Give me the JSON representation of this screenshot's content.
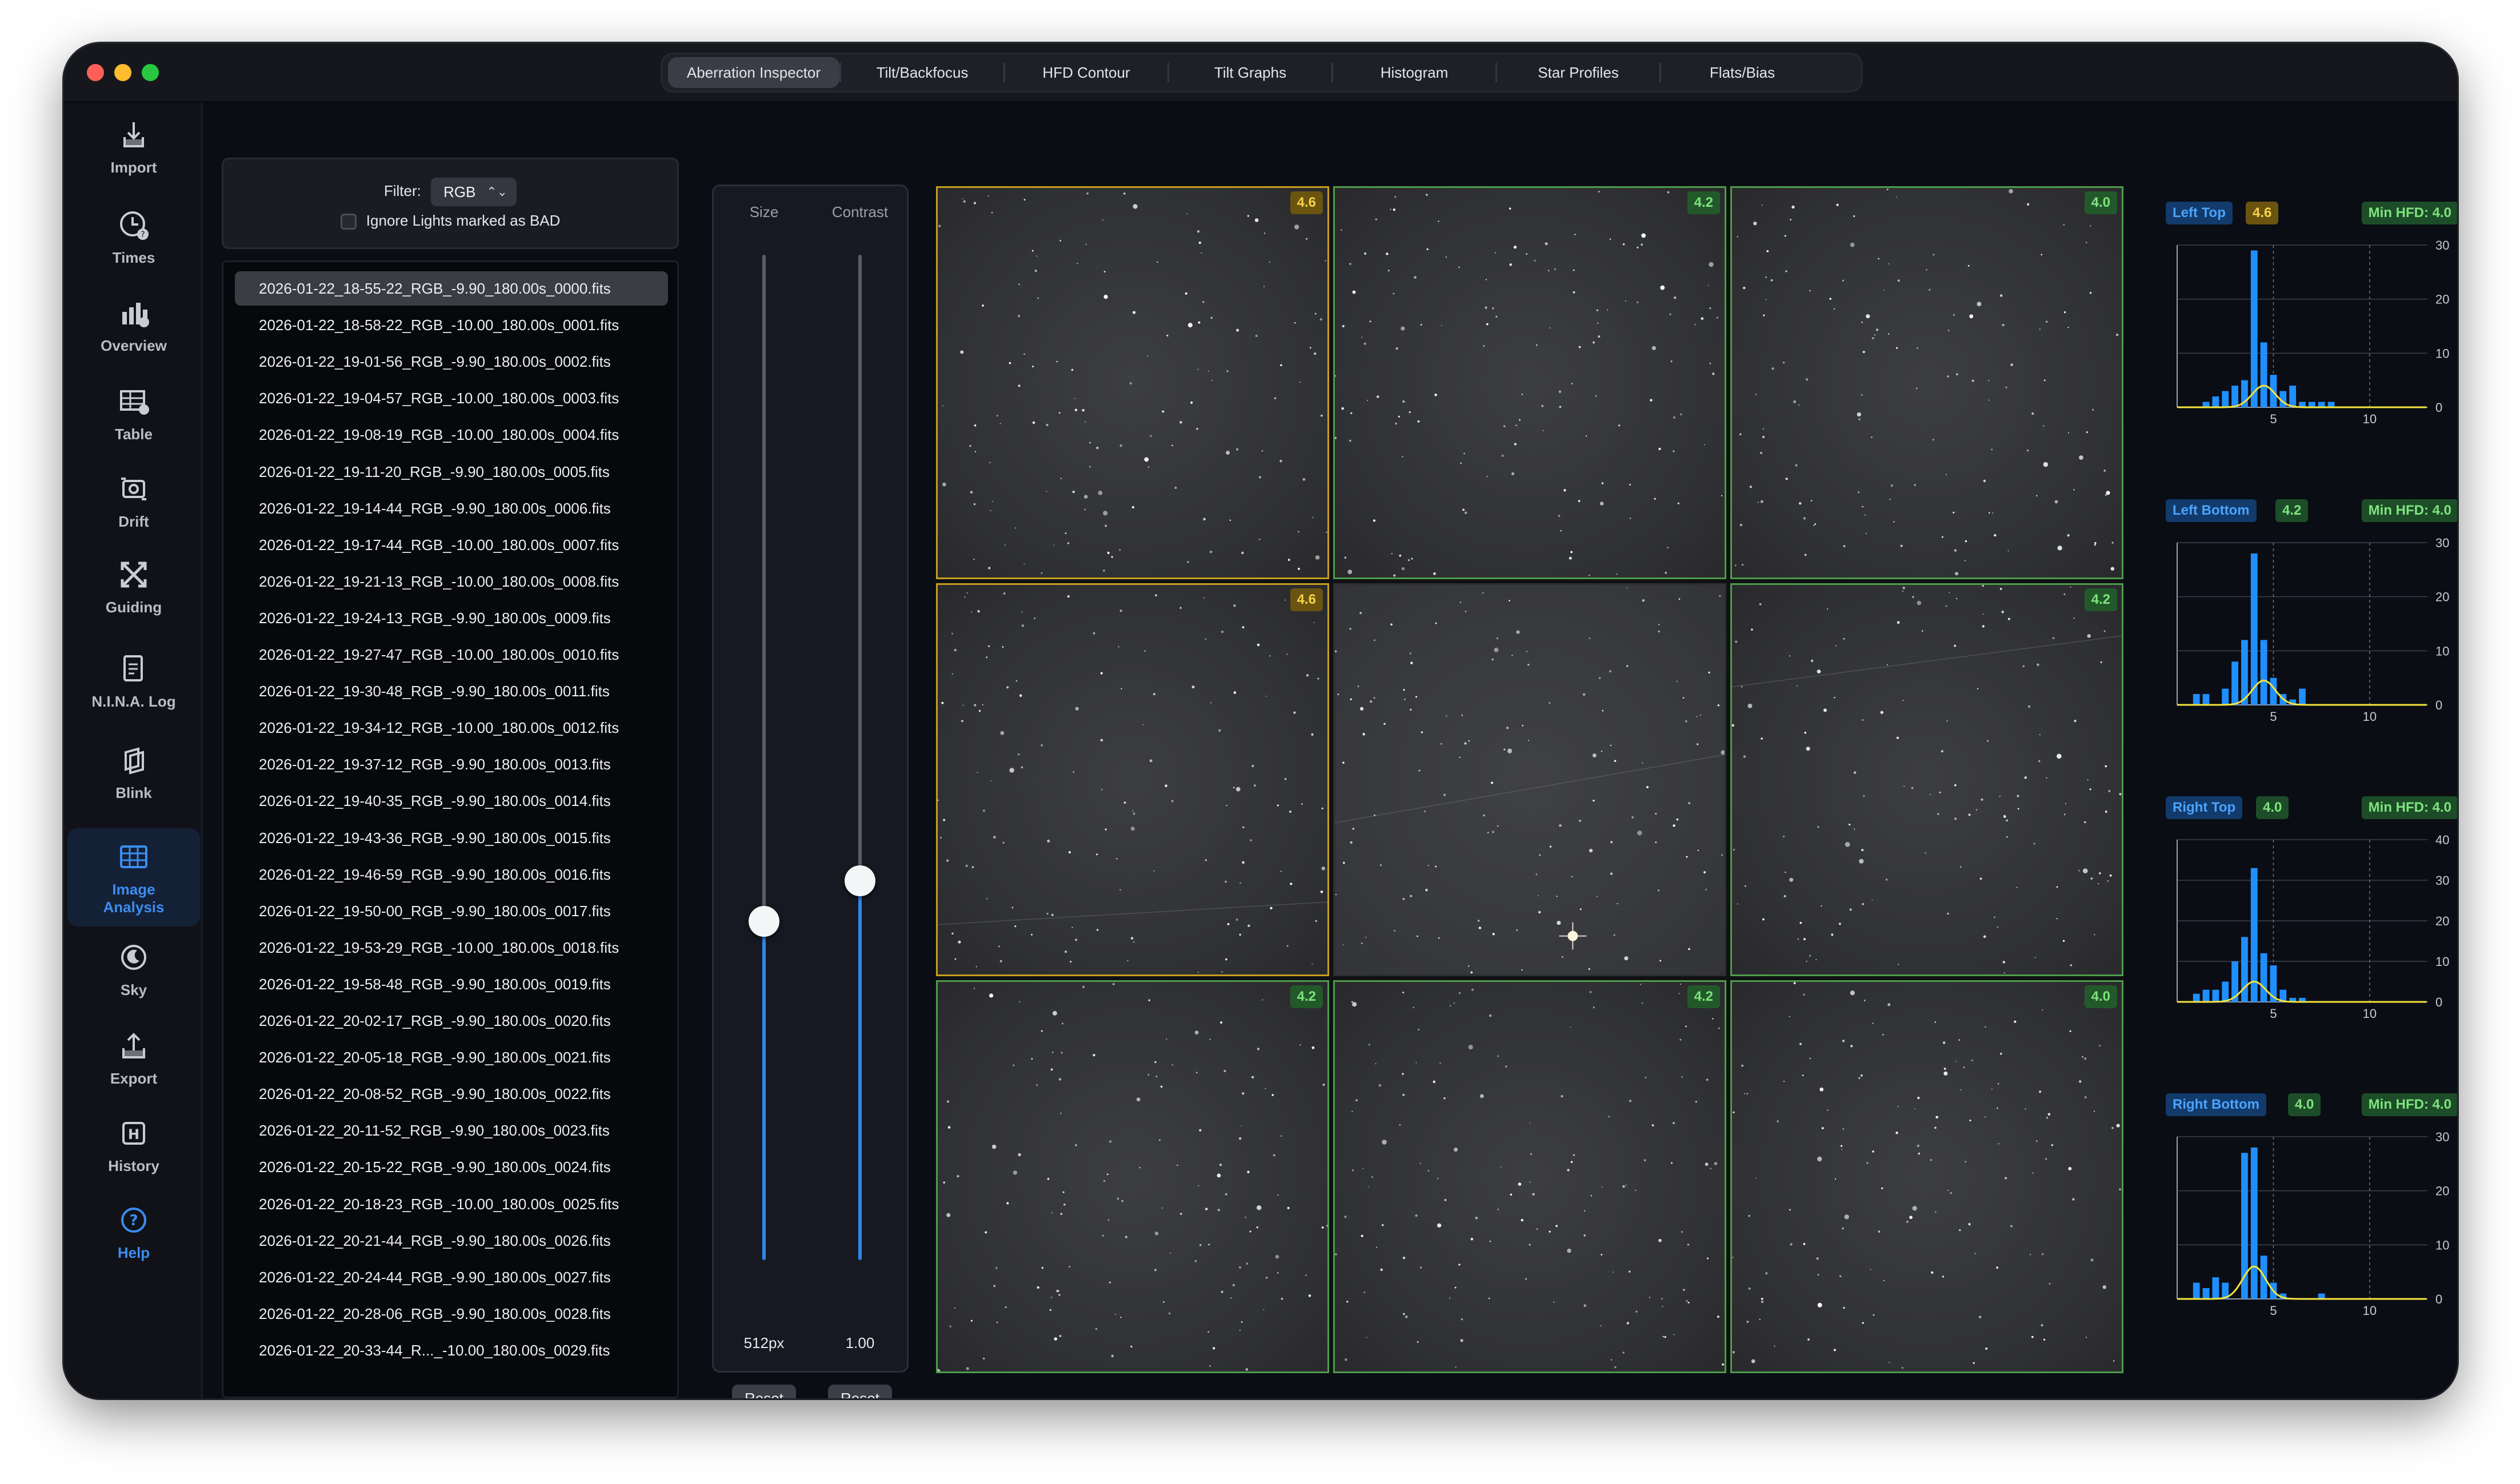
{
  "tabs": [
    {
      "label": "Aberration Inspector",
      "active": true
    },
    {
      "label": "Tilt/Backfocus",
      "active": false
    },
    {
      "label": "HFD Contour",
      "active": false
    },
    {
      "label": "Tilt Graphs",
      "active": false
    },
    {
      "label": "Histogram",
      "active": false
    },
    {
      "label": "Star Profiles",
      "active": false
    },
    {
      "label": "Flats/Bias",
      "active": false
    }
  ],
  "sidebar": [
    {
      "label": "Import",
      "icon": "import-icon"
    },
    {
      "label": "Times",
      "icon": "clock-icon"
    },
    {
      "label": "Overview",
      "icon": "bar-chart-icon"
    },
    {
      "label": "Table",
      "icon": "table-icon"
    },
    {
      "label": "Drift",
      "icon": "camera-drift-icon"
    },
    {
      "label": "Guiding",
      "icon": "guiding-arrows-icon"
    },
    {
      "label": "N.I.N.A. Log",
      "icon": "log-document-icon"
    },
    {
      "label": "Blink",
      "icon": "blink-layers-icon"
    },
    {
      "label": "Image\nAnalysis",
      "icon": "grid-icon",
      "active": true
    },
    {
      "label": "Sky",
      "icon": "moon-icon"
    },
    {
      "label": "Export",
      "icon": "export-icon"
    },
    {
      "label": "History",
      "icon": "history-icon"
    },
    {
      "label": "Help",
      "icon": "help-icon"
    }
  ],
  "filter": {
    "label": "Filter:",
    "value": "RGB",
    "ignore_label": "Ignore Lights marked as BAD",
    "ignore_checked": false
  },
  "files": [
    "2026-01-22_18-55-22_RGB_-9.90_180.00s_0000.fits",
    "2026-01-22_18-58-22_RGB_-10.00_180.00s_0001.fits",
    "2026-01-22_19-01-56_RGB_-9.90_180.00s_0002.fits",
    "2026-01-22_19-04-57_RGB_-10.00_180.00s_0003.fits",
    "2026-01-22_19-08-19_RGB_-10.00_180.00s_0004.fits",
    "2026-01-22_19-11-20_RGB_-9.90_180.00s_0005.fits",
    "2026-01-22_19-14-44_RGB_-9.90_180.00s_0006.fits",
    "2026-01-22_19-17-44_RGB_-10.00_180.00s_0007.fits",
    "2026-01-22_19-21-13_RGB_-10.00_180.00s_0008.fits",
    "2026-01-22_19-24-13_RGB_-9.90_180.00s_0009.fits",
    "2026-01-22_19-27-47_RGB_-10.00_180.00s_0010.fits",
    "2026-01-22_19-30-48_RGB_-9.90_180.00s_0011.fits",
    "2026-01-22_19-34-12_RGB_-10.00_180.00s_0012.fits",
    "2026-01-22_19-37-12_RGB_-9.90_180.00s_0013.fits",
    "2026-01-22_19-40-35_RGB_-9.90_180.00s_0014.fits",
    "2026-01-22_19-43-36_RGB_-9.90_180.00s_0015.fits",
    "2026-01-22_19-46-59_RGB_-9.90_180.00s_0016.fits",
    "2026-01-22_19-50-00_RGB_-9.90_180.00s_0017.fits",
    "2026-01-22_19-53-29_RGB_-10.00_180.00s_0018.fits",
    "2026-01-22_19-58-48_RGB_-9.90_180.00s_0019.fits",
    "2026-01-22_20-02-17_RGB_-9.90_180.00s_0020.fits",
    "2026-01-22_20-05-18_RGB_-9.90_180.00s_0021.fits",
    "2026-01-22_20-08-52_RGB_-9.90_180.00s_0022.fits",
    "2026-01-22_20-11-52_RGB_-9.90_180.00s_0023.fits",
    "2026-01-22_20-15-22_RGB_-9.90_180.00s_0024.fits",
    "2026-01-22_20-18-23_RGB_-10.00_180.00s_0025.fits",
    "2026-01-22_20-21-44_RGB_-9.90_180.00s_0026.fits",
    "2026-01-22_20-24-44_RGB_-9.90_180.00s_0027.fits",
    "2026-01-22_20-28-06_RGB_-9.90_180.00s_0028.fits",
    "2026-01-22_20-33-44_R..._-10.00_180.00s_0029.fits"
  ],
  "selected_file_index": 0,
  "sliders": {
    "size": {
      "title": "Size",
      "value_label": "512px",
      "position": 0.337,
      "reset_label": "Reset"
    },
    "contrast": {
      "title": "Contrast",
      "value_label": "1.00",
      "position": 0.377,
      "reset_label": "Reset"
    }
  },
  "tiles": [
    {
      "hfd": "4.6",
      "status": "warn"
    },
    {
      "hfd": "4.2",
      "status": "good"
    },
    {
      "hfd": "4.0",
      "status": "good"
    },
    {
      "hfd": "4.6",
      "status": "warn"
    },
    {
      "hfd": "",
      "status": "center"
    },
    {
      "hfd": "4.2",
      "status": "good"
    },
    {
      "hfd": "4.2",
      "status": "good"
    },
    {
      "hfd": "4.2",
      "status": "good"
    },
    {
      "hfd": "4.0",
      "status": "good"
    }
  ],
  "colors": {
    "accent": "#3b8df0",
    "good_border": "#4d9c4a",
    "warn_border": "#c79e1c",
    "bar": "#1f8fff",
    "curve": "#f5e33b"
  },
  "chart_data": [
    {
      "type": "bar",
      "title": "Left Top",
      "hfd": "4.6",
      "hfd_status": "warn",
      "min_label": "Min HFD: 4.0",
      "x": [
        1.5,
        2,
        2.5,
        3,
        3.5,
        4,
        4.5,
        5,
        5.5,
        6,
        6.5,
        7,
        7.5,
        8
      ],
      "values": [
        1,
        2,
        3,
        4,
        5,
        29,
        12,
        6,
        3,
        4,
        1,
        1,
        1,
        1
      ],
      "xlim": [
        0,
        13
      ],
      "ylim": [
        0,
        30
      ],
      "yticks": [
        0,
        10,
        20,
        30
      ],
      "xticks": [
        5,
        10
      ],
      "series": [
        {
          "type": "curve",
          "peak_x": 4.5,
          "peak_y": 4
        }
      ]
    },
    {
      "type": "bar",
      "title": "Left Bottom",
      "hfd": "4.2",
      "hfd_status": "good",
      "min_label": "Min HFD: 4.0",
      "x": [
        1,
        1.5,
        2.5,
        3,
        3.5,
        4,
        4.5,
        5,
        5.5,
        6,
        6.5
      ],
      "values": [
        2,
        2,
        3,
        8,
        12,
        28,
        12,
        5,
        2,
        1,
        3
      ],
      "xlim": [
        0,
        13
      ],
      "ylim": [
        0,
        30
      ],
      "yticks": [
        0,
        10,
        20,
        30
      ],
      "xticks": [
        5,
        10
      ],
      "series": [
        {
          "type": "curve",
          "peak_x": 4.5,
          "peak_y": 4.5
        }
      ]
    },
    {
      "type": "bar",
      "title": "Right Top",
      "hfd": "4.0",
      "hfd_status": "good",
      "min_label": "Min HFD: 4.0",
      "x": [
        1,
        1.5,
        2,
        2.5,
        3,
        3.5,
        4,
        4.5,
        5,
        5.5,
        6,
        6.5
      ],
      "values": [
        2,
        3,
        3,
        5,
        10,
        16,
        33,
        12,
        9,
        3,
        1,
        1
      ],
      "xlim": [
        0,
        13
      ],
      "ylim": [
        0,
        40
      ],
      "yticks": [
        0,
        10,
        20,
        30,
        40
      ],
      "xticks": [
        5,
        10
      ],
      "series": [
        {
          "type": "curve",
          "peak_x": 4.0,
          "peak_y": 5
        }
      ]
    },
    {
      "type": "bar",
      "title": "Right Bottom",
      "hfd": "4.0",
      "hfd_status": "good",
      "min_label": "Min HFD: 4.0",
      "x": [
        1,
        1.5,
        2,
        2.5,
        3.5,
        4,
        4.5,
        5,
        5.5,
        7.5
      ],
      "values": [
        3,
        2,
        4,
        3,
        27,
        28,
        8,
        3,
        1,
        1
      ],
      "xlim": [
        0,
        13
      ],
      "ylim": [
        0,
        30
      ],
      "yticks": [
        0,
        10,
        20,
        30
      ],
      "xticks": [
        5,
        10
      ],
      "series": [
        {
          "type": "curve",
          "peak_x": 4.0,
          "peak_y": 6
        }
      ]
    }
  ]
}
